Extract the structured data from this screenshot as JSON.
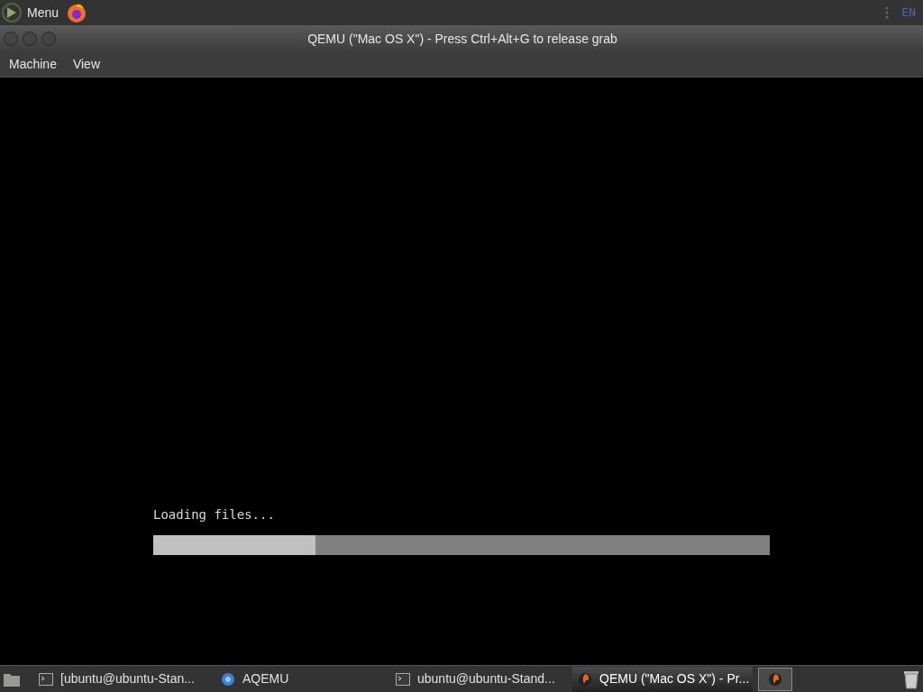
{
  "top_panel": {
    "menu_label": "Menu",
    "keyboard_layout": "EN"
  },
  "window": {
    "title": "QEMU (\"Mac OS X\") - Press Ctrl+Alt+G to release grab"
  },
  "menubar": [
    "Machine",
    "View"
  ],
  "screen": {
    "message": "Loading files...",
    "progress": {
      "level": 0.263
    }
  },
  "taskbar": {
    "items": [
      {
        "label": "[ubuntu@ubuntu-Stan...",
        "kind": "terminal",
        "selected": false
      },
      {
        "label": "AQEMU",
        "kind": "aqemu",
        "selected": false
      },
      {
        "label": "ubuntu@ubuntu-Stand...",
        "kind": "terminal",
        "selected": false
      },
      {
        "label": "QEMU (\"Mac OS X\") - Pr...",
        "kind": "qemu",
        "selected": true
      }
    ]
  }
}
